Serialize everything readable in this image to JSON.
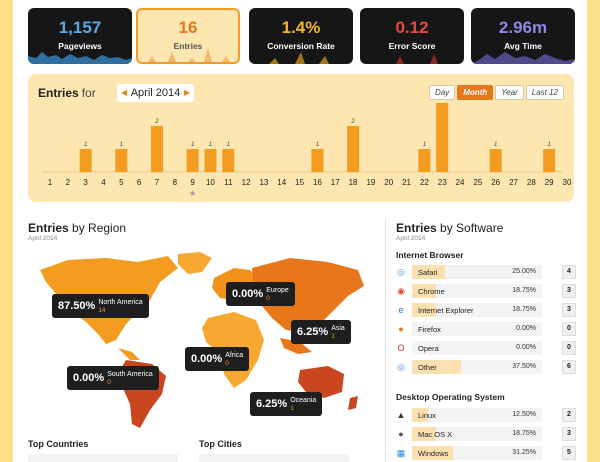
{
  "metrics": [
    {
      "value": "1,157",
      "label": "Pageviews",
      "color": "#5aa9e6"
    },
    {
      "value": "16",
      "label": "Entries",
      "color": "#e8761a"
    },
    {
      "value": "1.4%",
      "label": "Conversion Rate",
      "color": "#f5b52a"
    },
    {
      "value": "0.12",
      "label": "Error Score",
      "color": "#e8493a"
    },
    {
      "value": "2.96m",
      "label": "Avg Time",
      "color": "#8e86e0"
    }
  ],
  "entries_chart": {
    "title": "Entries",
    "for_label": "for",
    "month_label": "April 2014",
    "ranges": [
      "Day",
      "Month",
      "Year",
      "Last 12"
    ],
    "selected_range": "Month"
  },
  "chart_data": {
    "type": "bar",
    "categories": [
      "1",
      "2",
      "3",
      "4",
      "5",
      "6",
      "7",
      "8",
      "9",
      "10",
      "11",
      "12",
      "13",
      "14",
      "15",
      "16",
      "17",
      "18",
      "19",
      "20",
      "21",
      "22",
      "23",
      "24",
      "25",
      "26",
      "27",
      "28",
      "29",
      "30"
    ],
    "values": [
      0,
      0,
      1,
      0,
      1,
      0,
      2,
      0,
      1,
      1,
      1,
      0,
      0,
      0,
      0,
      1,
      0,
      2,
      0,
      0,
      0,
      1,
      3,
      0,
      0,
      1,
      0,
      0,
      1,
      0
    ],
    "marked_day": "9",
    "color": "#f39c1f"
  },
  "region": {
    "title": "Entries",
    "by": "by Region",
    "subtitle": "April 2014",
    "callouts": [
      {
        "pct": "87.50%",
        "name": "North America",
        "count": "14"
      },
      {
        "pct": "0.00%",
        "name": "Europe",
        "count": "0"
      },
      {
        "pct": "6.25%",
        "name": "Asia",
        "count": "1"
      },
      {
        "pct": "0.00%",
        "name": "Africa",
        "count": "0"
      },
      {
        "pct": "0.00%",
        "name": "South America",
        "count": "0"
      },
      {
        "pct": "6.25%",
        "name": "Oceania",
        "count": "1"
      }
    ]
  },
  "top_countries": {
    "title": "Top Countries"
  },
  "top_cities": {
    "title": "Top Cities"
  },
  "software": {
    "title": "Entries",
    "by": "by Software",
    "subtitle": "April 2014",
    "browser_title": "Internet Browser",
    "browsers": [
      {
        "name": "Safari",
        "pct": "25.00%",
        "count": "4",
        "fill": 0.25,
        "icon": "safari-icon"
      },
      {
        "name": "Chrome",
        "pct": "18.75%",
        "count": "3",
        "fill": 0.1875,
        "icon": "chrome-icon"
      },
      {
        "name": "Internet Explorer",
        "pct": "18.75%",
        "count": "3",
        "fill": 0.1875,
        "icon": "ie-icon"
      },
      {
        "name": "Firefox",
        "pct": "0.00%",
        "count": "0",
        "fill": 0,
        "icon": "firefox-icon"
      },
      {
        "name": "Opera",
        "pct": "0.00%",
        "count": "0",
        "fill": 0,
        "icon": "opera-icon"
      },
      {
        "name": "Other",
        "pct": "37.50%",
        "count": "6",
        "fill": 0.375,
        "icon": "globe-icon"
      }
    ],
    "os_title": "Desktop Operating System",
    "os": [
      {
        "name": "Linux",
        "pct": "12.50%",
        "count": "2",
        "fill": 0.125,
        "icon": "linux-icon"
      },
      {
        "name": "Mac OS X",
        "pct": "18.75%",
        "count": "3",
        "fill": 0.1875,
        "icon": "apple-icon"
      },
      {
        "name": "Windows",
        "pct": "31.25%",
        "count": "5",
        "fill": 0.3125,
        "icon": "windows-icon"
      }
    ]
  }
}
